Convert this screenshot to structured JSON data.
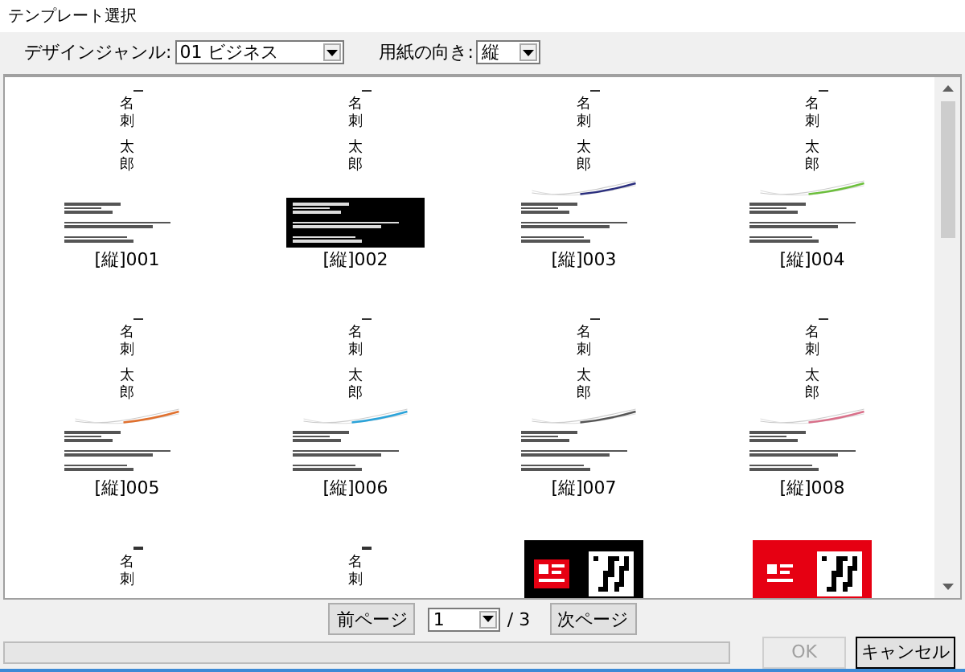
{
  "window": {
    "title": "テンプレート選択"
  },
  "toolbar": {
    "genre_label": "デザインジャンル:",
    "genre_value": "01 ビジネス",
    "orientation_label": "用紙の向き:",
    "orientation_value": "縦"
  },
  "templates": [
    {
      "label": "[縦]001",
      "kind": "plain",
      "name_chars": [
        "名",
        "刺",
        "太",
        "郎"
      ]
    },
    {
      "label": "[縦]002",
      "kind": "black",
      "name_chars": [
        "名",
        "刺",
        "太",
        "郎"
      ]
    },
    {
      "label": "[縦]003",
      "kind": "wave",
      "color": "#2b2f7e",
      "name_chars": [
        "名",
        "刺",
        "太",
        "郎"
      ]
    },
    {
      "label": "[縦]004",
      "kind": "wave",
      "color": "#6cbf3c",
      "name_chars": [
        "名",
        "刺",
        "太",
        "郎"
      ]
    },
    {
      "label": "[縦]005",
      "kind": "wave",
      "color": "#e0702e",
      "name_chars": [
        "名",
        "刺",
        "太",
        "郎"
      ]
    },
    {
      "label": "[縦]006",
      "kind": "wave",
      "color": "#2ba3d9",
      "name_chars": [
        "名",
        "刺",
        "太",
        "郎"
      ]
    },
    {
      "label": "[縦]007",
      "kind": "wave",
      "color": "#555555",
      "name_chars": [
        "名",
        "刺",
        "太",
        "郎"
      ]
    },
    {
      "label": "[縦]008",
      "kind": "wave",
      "color": "#d9708a",
      "name_chars": [
        "名",
        "刺",
        "太",
        "郎"
      ]
    },
    {
      "kind": "plain",
      "name_chars": [
        "名",
        "刺"
      ]
    },
    {
      "kind": "plain",
      "name_chars": [
        "名",
        "刺"
      ]
    },
    {
      "kind": "qr",
      "color": "#000000"
    },
    {
      "kind": "qr",
      "color": "#e60012"
    }
  ],
  "pager": {
    "prev": "前ページ",
    "page": "1",
    "total": "/ 3",
    "next": "次ページ"
  },
  "buttons": [
    {
      "label": "OK",
      "disabled": true
    },
    {
      "label": "キャンセル",
      "disabled": false
    }
  ]
}
